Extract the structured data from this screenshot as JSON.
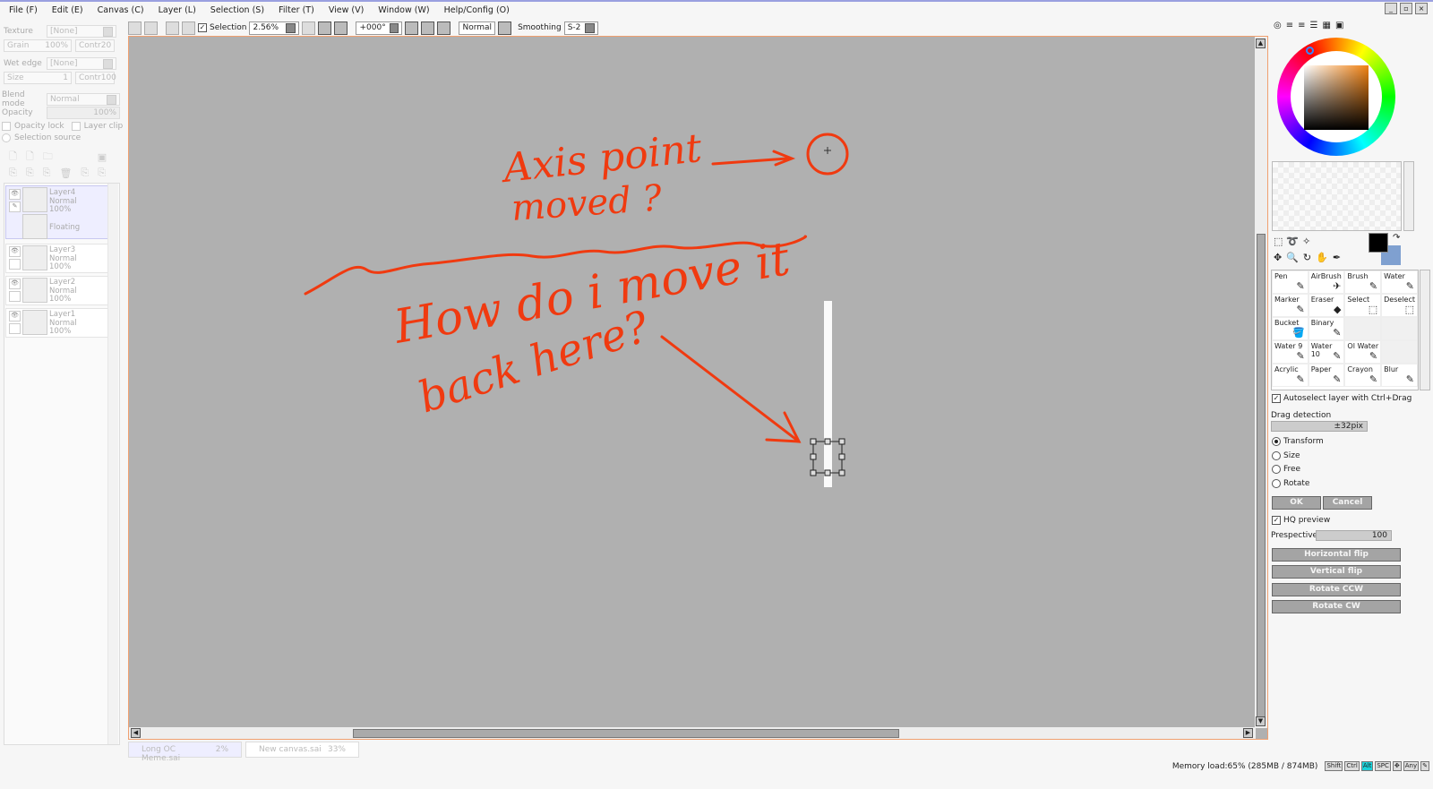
{
  "menu": [
    "File (F)",
    "Edit (E)",
    "Canvas (C)",
    "Layer (L)",
    "Selection (S)",
    "Filter (T)",
    "View (V)",
    "Window (W)",
    "Help/Config (O)"
  ],
  "toolbar": {
    "selection_label": "Selection",
    "zoom": "2.56%",
    "angle": "+000°",
    "blend": "Normal",
    "smoothing_label": "Smoothing",
    "smoothing": "S-2"
  },
  "left": {
    "texture_label": "Texture",
    "texture": "[None]",
    "grain_label": "Grain",
    "grain": "100%",
    "contr_label": "Contr",
    "contr1": "20",
    "wet_label": "Wet edge",
    "wet": "[None]",
    "size_label": "Size",
    "size": "1",
    "contr2": "100",
    "blend_label": "Blend mode",
    "blend": "Normal",
    "opacity_label": "Opacity",
    "opacity": "100%",
    "opacity_lock": "Opacity lock",
    "layer_clip": "Layer clip",
    "selection_source": "Selection source"
  },
  "layers": [
    {
      "name": "Layer4",
      "mode": "Normal",
      "opacity": "100%",
      "floating": "Floating"
    },
    {
      "name": "Layer3",
      "mode": "Normal",
      "opacity": "100%"
    },
    {
      "name": "Layer2",
      "mode": "Normal",
      "opacity": "100%"
    },
    {
      "name": "Layer1",
      "mode": "Normal",
      "opacity": "100%"
    }
  ],
  "annotations": {
    "line1": "Axis point",
    "line2": "moved ?",
    "line3": "How do i move it",
    "line4": "back here?"
  },
  "tools": [
    {
      "label": "Pen"
    },
    {
      "label": "AirBrush"
    },
    {
      "label": "Brush"
    },
    {
      "label": "Water"
    },
    {
      "label": "Marker"
    },
    {
      "label": "Eraser"
    },
    {
      "label": "Select"
    },
    {
      "label": "Deselect"
    },
    {
      "label": "Bucket"
    },
    {
      "label": "Binary"
    },
    {
      "label": ""
    },
    {
      "label": ""
    },
    {
      "label": "Water 9"
    },
    {
      "label": "Water 10"
    },
    {
      "label": "Ol Water"
    },
    {
      "label": ""
    },
    {
      "label": "Acrylic"
    },
    {
      "label": "Paper"
    },
    {
      "label": "Crayon"
    },
    {
      "label": "Blur"
    }
  ],
  "transform": {
    "autoselect": "Autoselect layer with Ctrl+Drag",
    "drag_label": "Drag detection",
    "drag": "±32pix",
    "modes": [
      "Transform",
      "Size",
      "Free",
      "Rotate"
    ],
    "ok": "OK",
    "cancel": "Cancel",
    "hq": "HQ preview",
    "persp_label": "Prespective",
    "persp": "100",
    "buttons": [
      "Horizontal flip",
      "Vertical flip",
      "Rotate CCW",
      "Rotate CW"
    ]
  },
  "tabs": [
    {
      "name": "Long OC Meme.sai",
      "pct": "2%"
    },
    {
      "name": "New canvas.sai",
      "pct": "33%"
    }
  ],
  "status": {
    "memory": "Memory load:65% (285MB / 874MB)",
    "keys": [
      "Shift",
      "Ctrl",
      "Alt",
      "SPC",
      "✥",
      "Any",
      "✎"
    ]
  },
  "colors": {
    "fg": "#000000",
    "bg": "#7fa0d0",
    "annotation": "#f03a10"
  }
}
